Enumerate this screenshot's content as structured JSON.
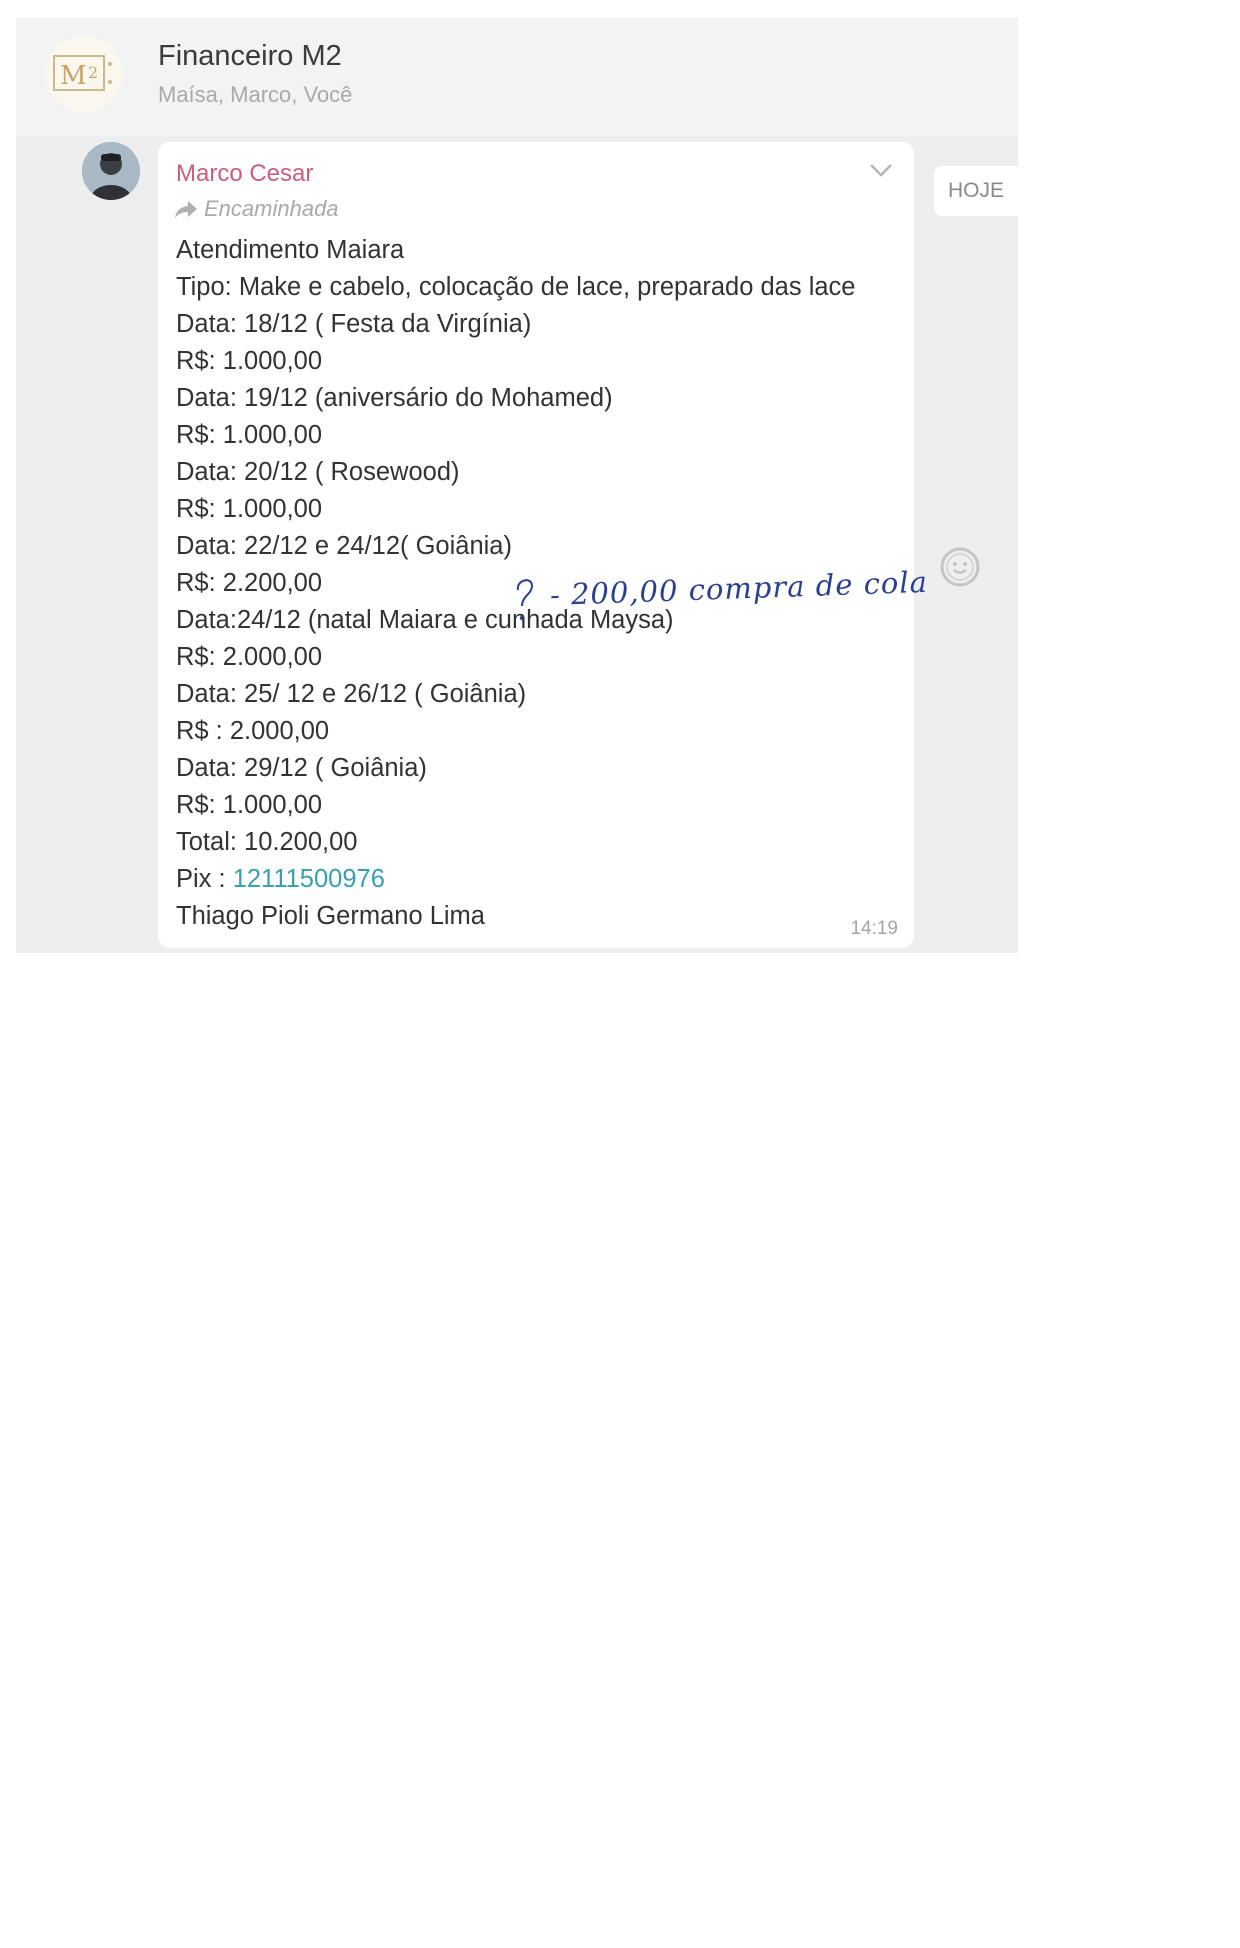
{
  "chat": {
    "title": "Financeiro M2",
    "members": "Maísa, Marco, Você",
    "date_chip": "HOJE"
  },
  "message": {
    "sender": "Marco Cesar",
    "forwarded_label": "Encaminhada",
    "lines": [
      "Atendimento Maiara",
      "Tipo: Make e cabelo, colocação de lace, preparado das lace",
      "Data: 18/12 ( Festa da Virgínia)",
      "R$: 1.000,00",
      "Data: 19/12 (aniversário do Mohamed)",
      "R$: 1.000,00",
      "Data: 20/12 ( Rosewood)",
      "R$: 1.000,00",
      "Data: 22/12 e 24/12( Goiânia)",
      "R$: 2.200,00",
      "Data:24/12 (natal Maiara e cunhada Maysa)",
      "R$: 2.000,00",
      "Data: 25/ 12 e 26/12 ( Goiânia)",
      "R$ : 2.000,00",
      "Data: 29/12 ( Goiânia)",
      "R$: 1.000,00",
      "Total: 10.200,00"
    ],
    "pix_label": "Pix : ",
    "pix_number": "12111500976",
    "signature": "Thiago Pioli Germano Lima",
    "time": "14:19"
  },
  "annotation": {
    "handwritten_text": "- 200,00 compra de cola"
  },
  "icons": {
    "group_avatar": "m2-logo-icon",
    "sender_avatar": "profile-photo-icon",
    "forwarded": "forward-arrow-icon",
    "chevron": "chevron-down-icon",
    "emoji": "smiley-icon"
  },
  "colors": {
    "sender_name": "#cc5d7e",
    "pix_link": "#3aa0ad",
    "chat_background": "#eeeeee",
    "handwriting_ink": "#2b3f8f"
  }
}
